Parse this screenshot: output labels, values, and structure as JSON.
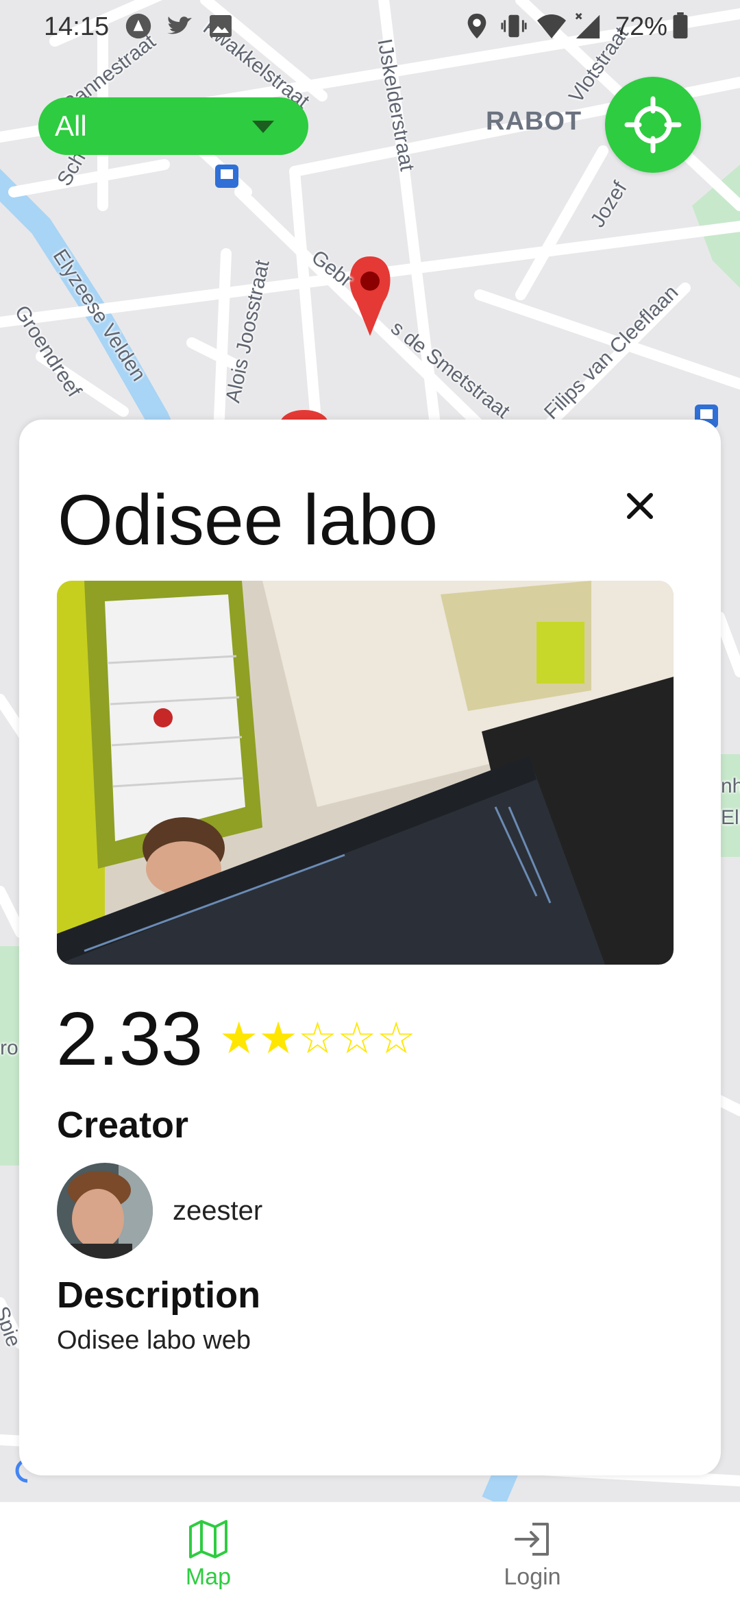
{
  "status_bar": {
    "time": "14:15",
    "battery": "72%"
  },
  "map": {
    "district_label": "RABOT",
    "streets": [
      "Pannestraat",
      "Kwakkelstraat",
      "IJskelderstraat",
      "Vlotstraat",
      "Sch",
      "Elyzeese Velden",
      "Groendreef",
      "Alois Joosstraat",
      "Gebr",
      "s de Smetstraat",
      "Jozef",
      "Filips van Cleeflaan",
      "nh",
      "Eli",
      "ro",
      "Spie"
    ]
  },
  "filter": {
    "selected": "All"
  },
  "card": {
    "title": "Odisee labo",
    "rating": "2.33",
    "rating_value": 2.33,
    "rating_max": 5,
    "creator_heading": "Creator",
    "creator_name": "zeester",
    "description_heading": "Description",
    "description": "Odisee labo web"
  },
  "bottom_nav": {
    "items": [
      {
        "label": "Map",
        "icon": "map-icon",
        "active": true
      },
      {
        "label": "Login",
        "icon": "login-icon",
        "active": false
      }
    ]
  },
  "colors": {
    "accent": "#2ecc40",
    "star": "#ffe600",
    "marker": "#e53935",
    "water": "#a8d4f5",
    "park": "#c8e8cc",
    "nav_inactive": "#707070"
  }
}
